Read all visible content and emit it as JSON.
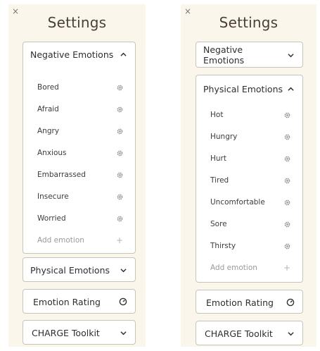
{
  "left": {
    "close": "×",
    "title": "Settings",
    "negative": {
      "label": "Negative Emotions",
      "items": [
        "Bored",
        "Afraid",
        "Angry",
        "Anxious",
        "Embarrassed",
        "Insecure",
        "Worried"
      ],
      "add_label": "Add emotion",
      "add_symbol": "+"
    },
    "physical": {
      "label": "Physical Emotions"
    },
    "rating": {
      "label": "Emotion Rating"
    },
    "charge": {
      "label": "CHARGE Toolkit"
    }
  },
  "right": {
    "close": "×",
    "title": "Settings",
    "negative": {
      "label": "Negative Emotions"
    },
    "physical": {
      "label": "Physical Emotions",
      "items": [
        "Hot",
        "Hungry",
        "Hurt",
        "Tired",
        "Uncomfortable",
        "Sore",
        "Thirsty"
      ],
      "add_label": "Add emotion",
      "add_symbol": "+"
    },
    "rating": {
      "label": "Emotion Rating"
    },
    "charge": {
      "label": "CHARGE Toolkit"
    }
  },
  "icons": {
    "close": "close-icon",
    "expanded": "chevron-up-icon",
    "collapsed": "chevron-down-icon",
    "item_action": "gear-icon",
    "rating": "gauge-icon",
    "add": "plus-icon"
  },
  "colors": {
    "panel_bg": "#faf6ec",
    "card_border": "#c9c4b8",
    "text": "#2e2e2e",
    "muted": "#9a9a9a"
  }
}
